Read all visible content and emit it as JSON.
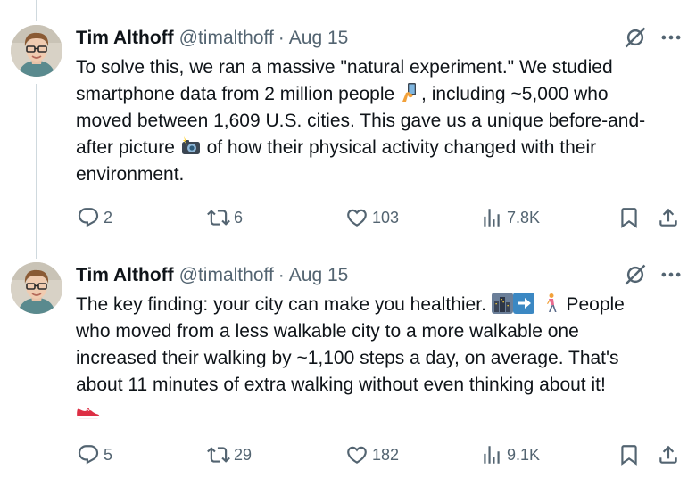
{
  "tweets": [
    {
      "author_name": "Tim Althoff",
      "handle": "@timalthoff",
      "separator": "·",
      "date": "Aug 15",
      "text": {
        "line1": "To solve this, we ran a massive \"natural experiment.\" We studied",
        "line2a": "smartphone data from 2 million people",
        "line2b": ", including ~5,000 who",
        "line3": "moved between 1,609 U.S. cities. This gave us a unique before-and-",
        "line4a": "after picture",
        "line4b": "of how their physical activity changed with their",
        "line5": "environment."
      },
      "emojis": [
        "selfie-emoji",
        "camera-flash-emoji"
      ],
      "stats": {
        "replies": "2",
        "reposts": "6",
        "likes": "103",
        "views": "7.8K"
      }
    },
    {
      "author_name": "Tim Althoff",
      "handle": "@timalthoff",
      "separator": "·",
      "date": "Aug 15",
      "text": {
        "line1a": "The key finding: your city can make you healthier.",
        "line1b": "People",
        "line2": "who moved from a less walkable city to a more walkable one",
        "line3": "increased their walking by ~1,100 steps a day, on average. That's",
        "line4": "about 11 minutes of extra walking without even thinking about it!"
      },
      "emojis": [
        "cityscape-emoji",
        "right-arrow-emoji",
        "person-walking-emoji",
        "sneaker-emoji"
      ],
      "stats": {
        "replies": "5",
        "reposts": "29",
        "likes": "182",
        "views": "9.1K"
      }
    }
  ],
  "colors": {
    "text_primary": "#0f1419",
    "text_secondary": "#536471",
    "thread_line": "#cfd9de"
  },
  "icons": [
    "reply-icon",
    "repost-icon",
    "like-icon",
    "views-icon",
    "bookmark-icon",
    "share-icon",
    "grok-icon",
    "more-icon"
  ]
}
